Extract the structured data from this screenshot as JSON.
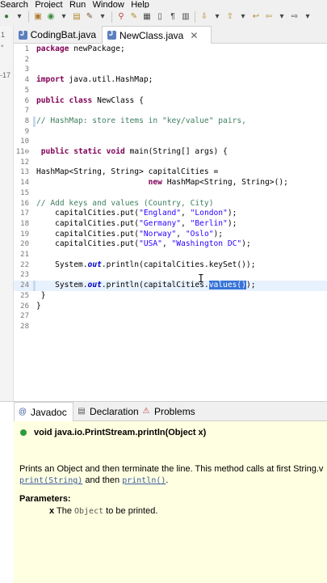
{
  "menubar": {
    "items": [
      "Search",
      "Project",
      "Run",
      "Window",
      "Help"
    ]
  },
  "gutter_labels": [
    "1",
    "°",
    "-17"
  ],
  "editor_tabs": [
    {
      "label": "CodingBat.java"
    },
    {
      "label": "NewClass.java",
      "active": true
    }
  ],
  "code_lines": [
    {
      "n": "1",
      "text": "package newPackage;"
    },
    {
      "n": "2",
      "text": ""
    },
    {
      "n": "3",
      "text": ""
    },
    {
      "n": "4",
      "text": "import java.util.HashMap;"
    },
    {
      "n": "5",
      "text": ""
    },
    {
      "n": "6",
      "text": "public class NewClass {"
    },
    {
      "n": "7",
      "text": ""
    },
    {
      "n": "8",
      "text": "// HashMap: store items in \"key/value\" pairs,"
    },
    {
      "n": "9",
      "text": ""
    },
    {
      "n": "10",
      "text": ""
    },
    {
      "n": "11⊖",
      "text": " public static void main(String[] args) {"
    },
    {
      "n": "12",
      "text": ""
    },
    {
      "n": "13",
      "text": "HashMap<String, String> capitalCities ="
    },
    {
      "n": "14",
      "text": "                        new HashMap<String, String>();"
    },
    {
      "n": "15",
      "text": ""
    },
    {
      "n": "16",
      "text": "// Add keys and values (Country, City)"
    },
    {
      "n": "17",
      "text": "    capitalCities.put(\"England\", \"London\");"
    },
    {
      "n": "18",
      "text": "    capitalCities.put(\"Germany\", \"Berlin\");"
    },
    {
      "n": "19",
      "text": "    capitalCities.put(\"Norway\", \"Oslo\");"
    },
    {
      "n": "20",
      "text": "    capitalCities.put(\"USA\", \"Washington DC\");"
    },
    {
      "n": "21",
      "text": ""
    },
    {
      "n": "22",
      "text": "    System.out.println(capitalCities.keySet());"
    },
    {
      "n": "23",
      "text": ""
    },
    {
      "n": "24",
      "text": "    System.out.println(capitalCities.values());"
    },
    {
      "n": "25",
      "text": " }"
    },
    {
      "n": "26",
      "text": "}"
    },
    {
      "n": "27",
      "text": ""
    },
    {
      "n": "28",
      "text": ""
    }
  ],
  "bottom_tabs": [
    {
      "label": "Javadoc",
      "active": true
    },
    {
      "label": "Declaration"
    },
    {
      "label": "Problems"
    }
  ],
  "javadoc": {
    "signature": "void java.io.PrintStream.println(Object x)",
    "desc_line1": "Prints an Object and then terminate the line. This method calls at first String.v",
    "link_print": "print(String)",
    "and_then": " and then ",
    "link_println": "println()",
    "period": ".",
    "params_label": "Parameters:",
    "param_name": "x",
    "param_the": " The ",
    "param_type": "Object",
    "param_rest": " to be printed."
  },
  "colors": {
    "keyword": "#7f0055",
    "comment": "#3f7f5f",
    "string": "#2a00ff",
    "selection": "#3874d8",
    "javadoc_bg": "#ffffe1"
  }
}
